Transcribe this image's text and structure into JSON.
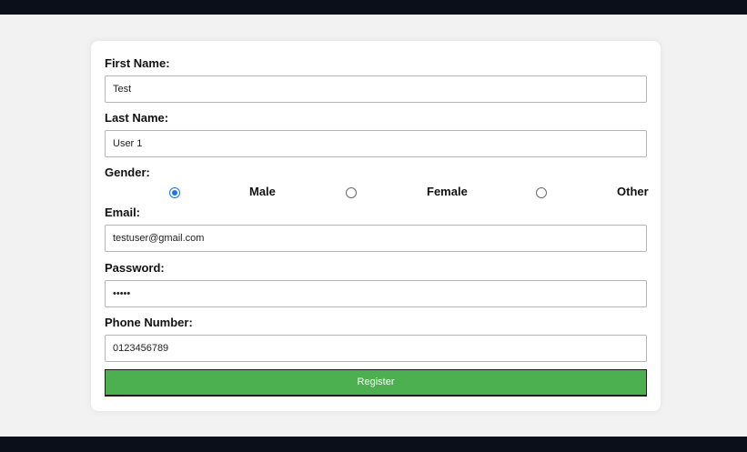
{
  "form": {
    "first_name": {
      "label": "First Name:",
      "value": "Test"
    },
    "last_name": {
      "label": "Last Name:",
      "value": "User 1"
    },
    "gender": {
      "label": "Gender:",
      "options": [
        {
          "label": "Male",
          "checked": true
        },
        {
          "label": "Female",
          "checked": false
        },
        {
          "label": "Other",
          "checked": false
        }
      ]
    },
    "email": {
      "label": "Email:",
      "value": "testuser@gmail.com"
    },
    "password": {
      "label": "Password:",
      "value": "•••••"
    },
    "phone": {
      "label": "Phone Number:",
      "value": "0123456789"
    },
    "submit_label": "Register"
  },
  "colors": {
    "accent": "#4caf50",
    "radio_checked": "#1a73e8",
    "background": "#f2f2f2",
    "frame": "#0a0f19"
  }
}
